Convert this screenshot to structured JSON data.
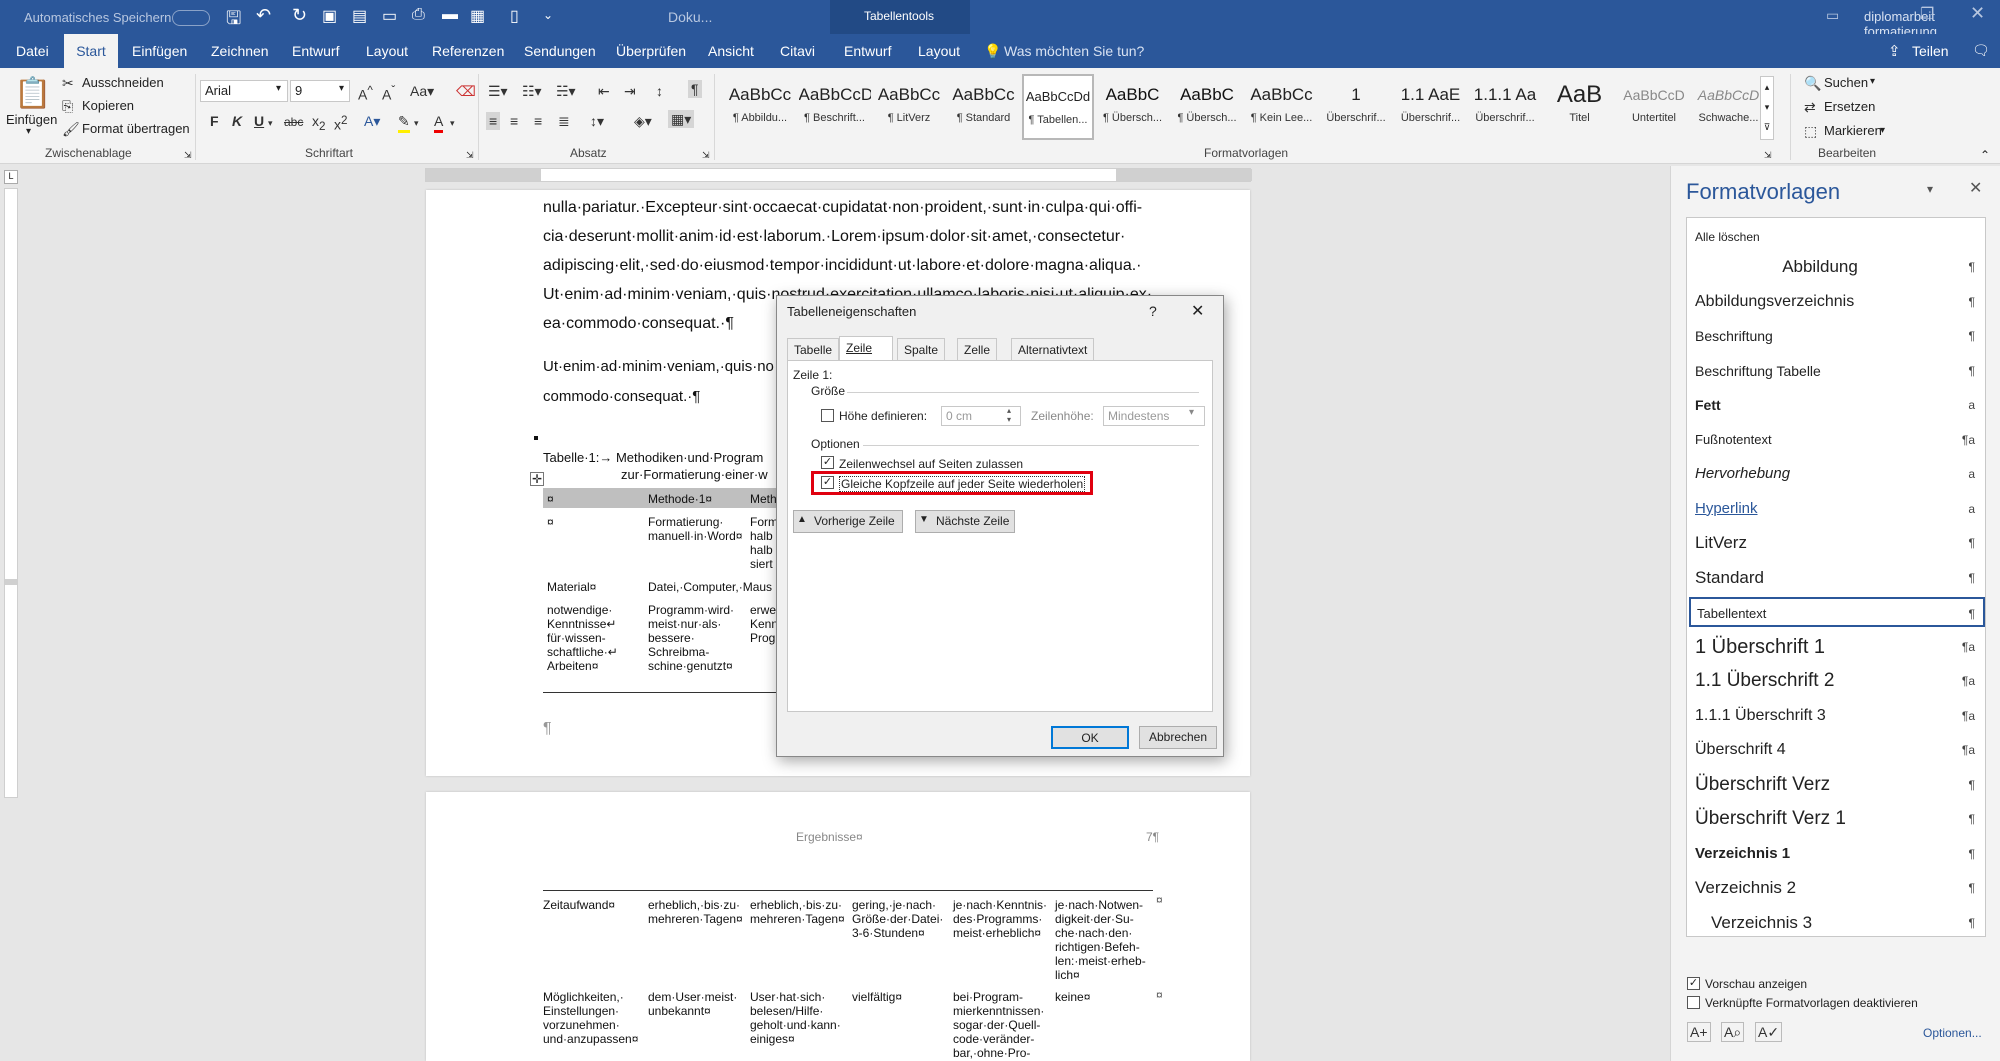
{
  "title_bar": {
    "autosave": "Automatisches Speichern",
    "doc_title": "Doku...",
    "context_tab": "Tabellentools",
    "account": "diplomarbeit formatierung"
  },
  "tabs": [
    "Datei",
    "Start",
    "Einfügen",
    "Zeichnen",
    "Entwurf",
    "Layout",
    "Referenzen",
    "Sendungen",
    "Überprüfen",
    "Ansicht",
    "Citavi",
    "Entwurf",
    "Layout"
  ],
  "tell_me": "Was möchten Sie tun?",
  "share": "Teilen",
  "clipboard": {
    "paste": "Einfügen",
    "cut": "Ausschneiden",
    "copy": "Kopieren",
    "format_painter": "Format übertragen",
    "label": "Zwischenablage"
  },
  "font": {
    "name": "Arial",
    "size": "9",
    "label": "Schriftart"
  },
  "paragraph": {
    "label": "Absatz"
  },
  "styles_gallery": {
    "label": "Formatvorlagen",
    "items": [
      {
        "preview": "AaBbCc",
        "name": "¶ Abbildu..."
      },
      {
        "preview": "AaBbCcD",
        "name": "¶ Beschrift..."
      },
      {
        "preview": "AaBbCc",
        "name": "¶ LitVerz"
      },
      {
        "preview": "AaBbCc",
        "name": "¶ Standard"
      },
      {
        "preview": "AaBbCcDd",
        "name": "¶ Tabellen..."
      },
      {
        "preview": "AaBbC",
        "name": "¶ Übersch..."
      },
      {
        "preview": "AaBbC",
        "name": "¶ Übersch..."
      },
      {
        "preview": "AaBbCc",
        "name": "¶ Kein Lee..."
      },
      {
        "preview": "1",
        "name": "Überschrif..."
      },
      {
        "preview": "1.1 AaE",
        "name": "Überschrif..."
      },
      {
        "preview": "1.1.1 Aa",
        "name": "Überschrif..."
      },
      {
        "preview": "AaB",
        "name": "Titel"
      },
      {
        "preview": "AaBbCcD",
        "name": "Untertitel"
      },
      {
        "preview": "AaBbCcD",
        "name": "Schwache..."
      }
    ]
  },
  "editing": {
    "find": "Suchen",
    "replace": "Ersetzen",
    "select": "Markieren",
    "label": "Bearbeiten"
  },
  "document": {
    "para1": [
      "nulla·pariatur.·Excepteur·sint·occaecat·cupidatat·non·proident,·sunt·in·culpa·qui·offi-",
      "cia·deserunt·mollit·anim·id·est·laborum.·Lorem·ipsum·dolor·sit·amet,·consectetur·",
      "adipiscing·elit,·sed·do·eiusmod·tempor·incididunt·ut·labore·et·dolore·magna·aliqua.·",
      "Ut·enim·ad·minim·veniam,·quis·nostrud·exercitation·ullamco·laboris·nisi·ut·aliquip·ex·",
      "ea·commodo·consequat.·¶"
    ],
    "para2": [
      "Ut·enim·ad·minim·veniam,·quis·no",
      "commodo·consequat.·¶"
    ],
    "caption1": "Tabelle·1:→ Methodiken·und·Program",
    "caption2": "zur·Formatierung·einer·w",
    "header_row": [
      "¤",
      "Methode·1¤",
      "Meth"
    ],
    "row1": {
      "c1": "¤",
      "c2": "Formatierung·\nmanuell·in·Word¤",
      "c3": "Form\nhalb\nhalb\nsiert"
    },
    "row2": {
      "c1": "Material¤",
      "c2": "Datei,·Computer,·Maus"
    },
    "row3": {
      "c1": "notwendige·\nKenntnisse↵\nfür·wissen-\nschaftliche·↵\nArbeiten¤",
      "c2": "Programm·wird·\nmeist·nur·als·\nbessere·\nSchreibma-\nschine·genutzt¤",
      "c3": "erwe\nKenn\nProg"
    },
    "pilcrow": "¶",
    "page2_header": "Ergebnisse¤",
    "page_num": "7¶",
    "row4": [
      "Zeitaufwand¤",
      "erheblich,·bis·zu·\nmehreren·Tagen¤",
      "erheblich,·bis·zu·\nmehreren·Tagen¤",
      "gering,·je·nach·\nGröße·der·Datei·\n3-6·Stunden¤",
      "je·nach·Kenntnis·\ndes·Programms·\nmeist·erheblich¤",
      "je·nach·Notwen-\ndigkeit·der·Su-\nche·nach·den·\nrichtigen·Befeh-\nlen:·meist·erheb-\nlich¤"
    ],
    "row5": [
      "Möglichkeiten,·\nEinstellungen·\nvorzunehmen·\nund·anzupassen¤",
      "dem·User·meist·\nunbekannt¤",
      "User·hat·sich·\nbelesen/Hilfe·\ngeholt·und·kann·\neiniges¤",
      "vielfältig¤",
      "bei·Program-\nmierkenntnissen·\nsogar·der·Quell-\ncode·veränder-\nbar,·ohne·Pro-",
      "keine¤"
    ]
  },
  "dialog": {
    "title": "Tabelleneigenschaften",
    "help": "?",
    "tabs": [
      "Tabelle",
      "Zeile",
      "Spalte",
      "Zelle",
      "Alternativtext"
    ],
    "row_label": "Zeile 1:",
    "size_label": "Größe",
    "height_checkbox": "Höhe definieren:",
    "height_value": "0 cm",
    "row_height_label": "Zeilenhöhe:",
    "row_height_value": "Mindestens",
    "options_label": "Optionen",
    "allow_break": "Zeilenwechsel auf Seiten zulassen",
    "repeat_header": "Gleiche Kopfzeile auf jeder Seite wiederholen",
    "prev_row": "Vorherige Zeile",
    "next_row": "Nächste Zeile",
    "ok": "OK",
    "cancel": "Abbrechen",
    "highlight_color": "#e0000f"
  },
  "styles_pane": {
    "title": "Formatvorlagen",
    "clear_all": "Alle löschen",
    "items": [
      {
        "name": "Abbildung",
        "mark": "¶"
      },
      {
        "name": "Abbildungsverzeichnis",
        "mark": "¶"
      },
      {
        "name": "Beschriftung",
        "mark": "¶"
      },
      {
        "name": "Beschriftung Tabelle",
        "mark": "¶"
      },
      {
        "name": "Fett",
        "mark": "a"
      },
      {
        "name": "Fußnotentext",
        "mark": "¶a"
      },
      {
        "name": "Hervorhebung",
        "mark": "a"
      },
      {
        "name": "Hyperlink",
        "mark": "a"
      },
      {
        "name": "LitVerz",
        "mark": "¶"
      },
      {
        "name": "Standard",
        "mark": "¶"
      },
      {
        "name": "Tabellentext",
        "mark": "¶"
      },
      {
        "name": "1  Überschrift 1",
        "mark": "¶a"
      },
      {
        "name": "1.1  Überschrift 2",
        "mark": "¶a"
      },
      {
        "name": "1.1.1  Überschrift 3",
        "mark": "¶a"
      },
      {
        "name": "Überschrift 4",
        "mark": "¶a"
      },
      {
        "name": "Überschrift Verz",
        "mark": "¶"
      },
      {
        "name": "Überschrift Verz 1",
        "mark": "¶"
      },
      {
        "name": "Verzeichnis 1",
        "mark": "¶"
      },
      {
        "name": "Verzeichnis 2",
        "mark": "¶"
      },
      {
        "name": "Verzeichnis 3",
        "mark": "¶"
      }
    ],
    "preview": "Vorschau anzeigen",
    "linked": "Verknüpfte Formatvorlagen deaktivieren",
    "options": "Optionen...",
    "accent": "#2b579a"
  }
}
